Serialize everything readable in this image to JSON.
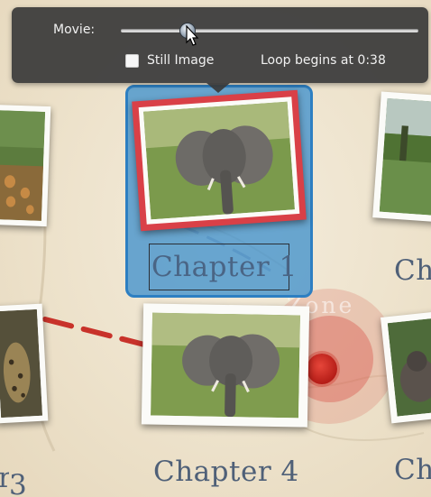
{
  "hud": {
    "movie_label": "Movie:",
    "slider_position": 0.22,
    "still_image_label": "Still Image",
    "still_image_checked": false,
    "loop_text": "Loop begins at 0:38"
  },
  "chapters": {
    "selected_label": "Chapter 1",
    "chapter_1": "Chapter",
    "chapter_1_numeral": "1",
    "chapter_4": "Chapter 4",
    "left_bottom_fragment": "3",
    "right_top_fragment": "Ch",
    "right_bottom_fragment": "Ch"
  },
  "map": {
    "zone_text": "Zone"
  },
  "colors": {
    "selection_fill": "#549bcd",
    "selection_border": "#2d7fc2",
    "hud_bg": "#3a3a3a",
    "route_red": "#c8322a",
    "label_blue": "#4f6078"
  },
  "icons": {
    "cursor": "arrow-cursor-icon",
    "hud_pointer": "triangle-pointer-icon",
    "map_pin": "map-pin-icon"
  }
}
